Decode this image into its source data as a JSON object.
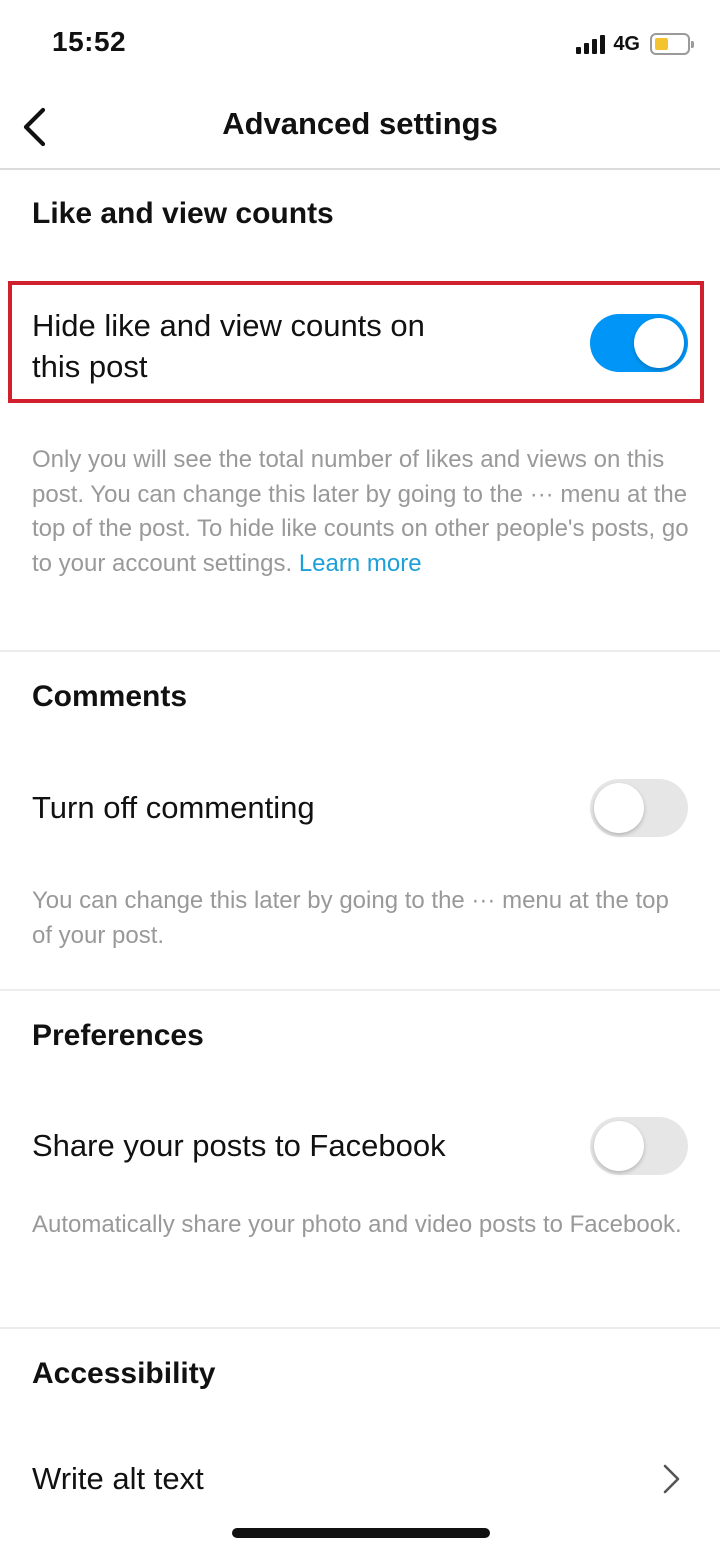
{
  "status_bar": {
    "time": "15:52",
    "network": "4G",
    "battery_color": "#f4c430"
  },
  "header": {
    "title": "Advanced settings",
    "back_icon": "chevron-left-icon"
  },
  "sections": {
    "likes": {
      "title": "Like and view counts",
      "row_label_line1": "Hide like and view counts on",
      "row_label_line2": "this post",
      "toggle_on": true,
      "description": "Only you will see the total number of likes and views on this post. You can change this later by going to the ··· menu at the top of the post. To hide like counts on other people's posts, go to your account settings.",
      "learn_more": "Learn more"
    },
    "comments": {
      "title": "Comments",
      "row_label": "Turn off commenting",
      "toggle_on": false,
      "description": "You can change this later by going to the ··· menu at the top of your post."
    },
    "preferences": {
      "title": "Preferences",
      "row_label": "Share your posts to Facebook",
      "toggle_on": false,
      "description": "Automatically share your photo and video posts to Facebook."
    },
    "accessibility": {
      "title": "Accessibility",
      "row_label": "Write alt text",
      "row_icon": "chevron-right-icon"
    }
  },
  "colors": {
    "toggle_on": "#0095f6",
    "toggle_off": "#e6e6e6",
    "link": "#1ca0d8",
    "highlight": "#d0202e"
  }
}
